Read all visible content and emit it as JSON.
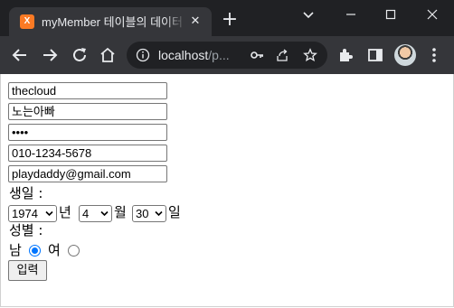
{
  "browser": {
    "tab_favicon": "X",
    "tab_title": "myMember 테이블의 데이터",
    "close_glyph": "✕",
    "new_tab_glyph": "+",
    "url_host": "localhost",
    "url_path": "/p...",
    "favicon_color": "#fb7a24"
  },
  "form": {
    "id_value": "thecloud",
    "nickname_value": "노는아빠",
    "password_value": "••••",
    "phone_value": "010-1234-5678",
    "email_value": "playdaddy@gmail.com",
    "birth_label": "생일 :",
    "year_selected": "1974",
    "year_unit": "년",
    "month_selected": "4",
    "month_unit": "월",
    "day_selected": "30",
    "day_unit": "일",
    "gender_label": "성별 :",
    "male_label": "남",
    "female_label": "여",
    "gender_selected": "male",
    "submit_label": "입력"
  },
  "colors": {
    "titlebar": "#202124",
    "toolbar": "#35363a",
    "radio_accent": "#0075ff"
  }
}
